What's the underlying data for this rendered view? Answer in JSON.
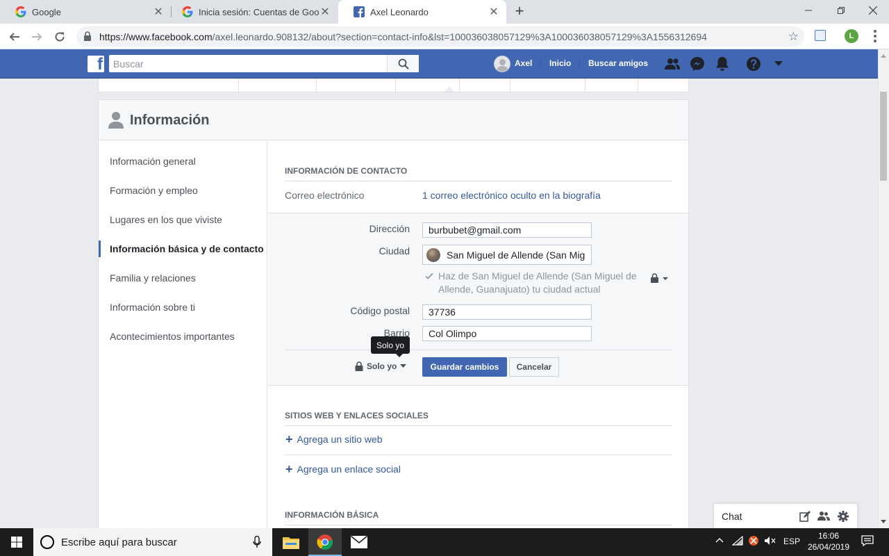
{
  "browser": {
    "tabs": [
      {
        "title": "Google",
        "favicon": "google-g-icon"
      },
      {
        "title": "Inicia sesión: Cuentas de Google",
        "favicon": "google-g-icon"
      },
      {
        "title": "Axel Leonardo",
        "favicon": "facebook-f-icon"
      }
    ],
    "url_host": "https://www.facebook.com",
    "url_path": "/axel.leonardo.908132/about?section=contact-info&lst=100036038057129%3A100036038057129%3A1556312694",
    "profile_initial": "L"
  },
  "fb": {
    "search_placeholder": "Buscar",
    "user_name": "Axel",
    "nav_home": "Inicio",
    "nav_find_friends": "Buscar amigos",
    "brand_color": "#4267b2"
  },
  "about": {
    "title": "Información",
    "sections": [
      {
        "label": "Información general"
      },
      {
        "label": "Formación y empleo"
      },
      {
        "label": "Lugares en los que viviste"
      },
      {
        "label": "Información básica y de contacto"
      },
      {
        "label": "Familia y relaciones"
      },
      {
        "label": "Información sobre ti"
      },
      {
        "label": "Acontecimientos importantes"
      }
    ],
    "active_section": "Información básica y de contacto"
  },
  "contact": {
    "header": "INFORMACIÓN DE CONTACTO",
    "email_label": "Correo electrónico",
    "email_value": "1 correo electrónico oculto en la biografía",
    "form": {
      "address_label": "Dirección",
      "address_value": "burbubet@gmail.com",
      "city_label": "Ciudad",
      "city_value": "San Miguel de Allende (San Mig",
      "current_city_checkbox": "Haz de San Miguel de Allende (San Miguel de Allende, Guanajuato) tu ciudad actual",
      "current_city_checked": true,
      "zip_label": "Código postal",
      "zip_value": "37736",
      "neighborhood_label": "Barrio",
      "neighborhood_value": "Col Olimpo",
      "tooltip": "Solo yo",
      "privacy_label": "Solo yo",
      "save_label": "Guardar cambios",
      "cancel_label": "Cancelar"
    }
  },
  "websites": {
    "header": "SITIOS WEB Y ENLACES SOCIALES",
    "add_website": "Agrega un sitio web",
    "add_social": "Agrega un enlace social"
  },
  "basic": {
    "header": "INFORMACIÓN BÁSICA"
  },
  "chat": {
    "label": "Chat"
  },
  "taskbar": {
    "search_placeholder": "Escribe aquí para buscar",
    "language": "ESP",
    "time": "16:06",
    "date": "26/04/2019"
  }
}
